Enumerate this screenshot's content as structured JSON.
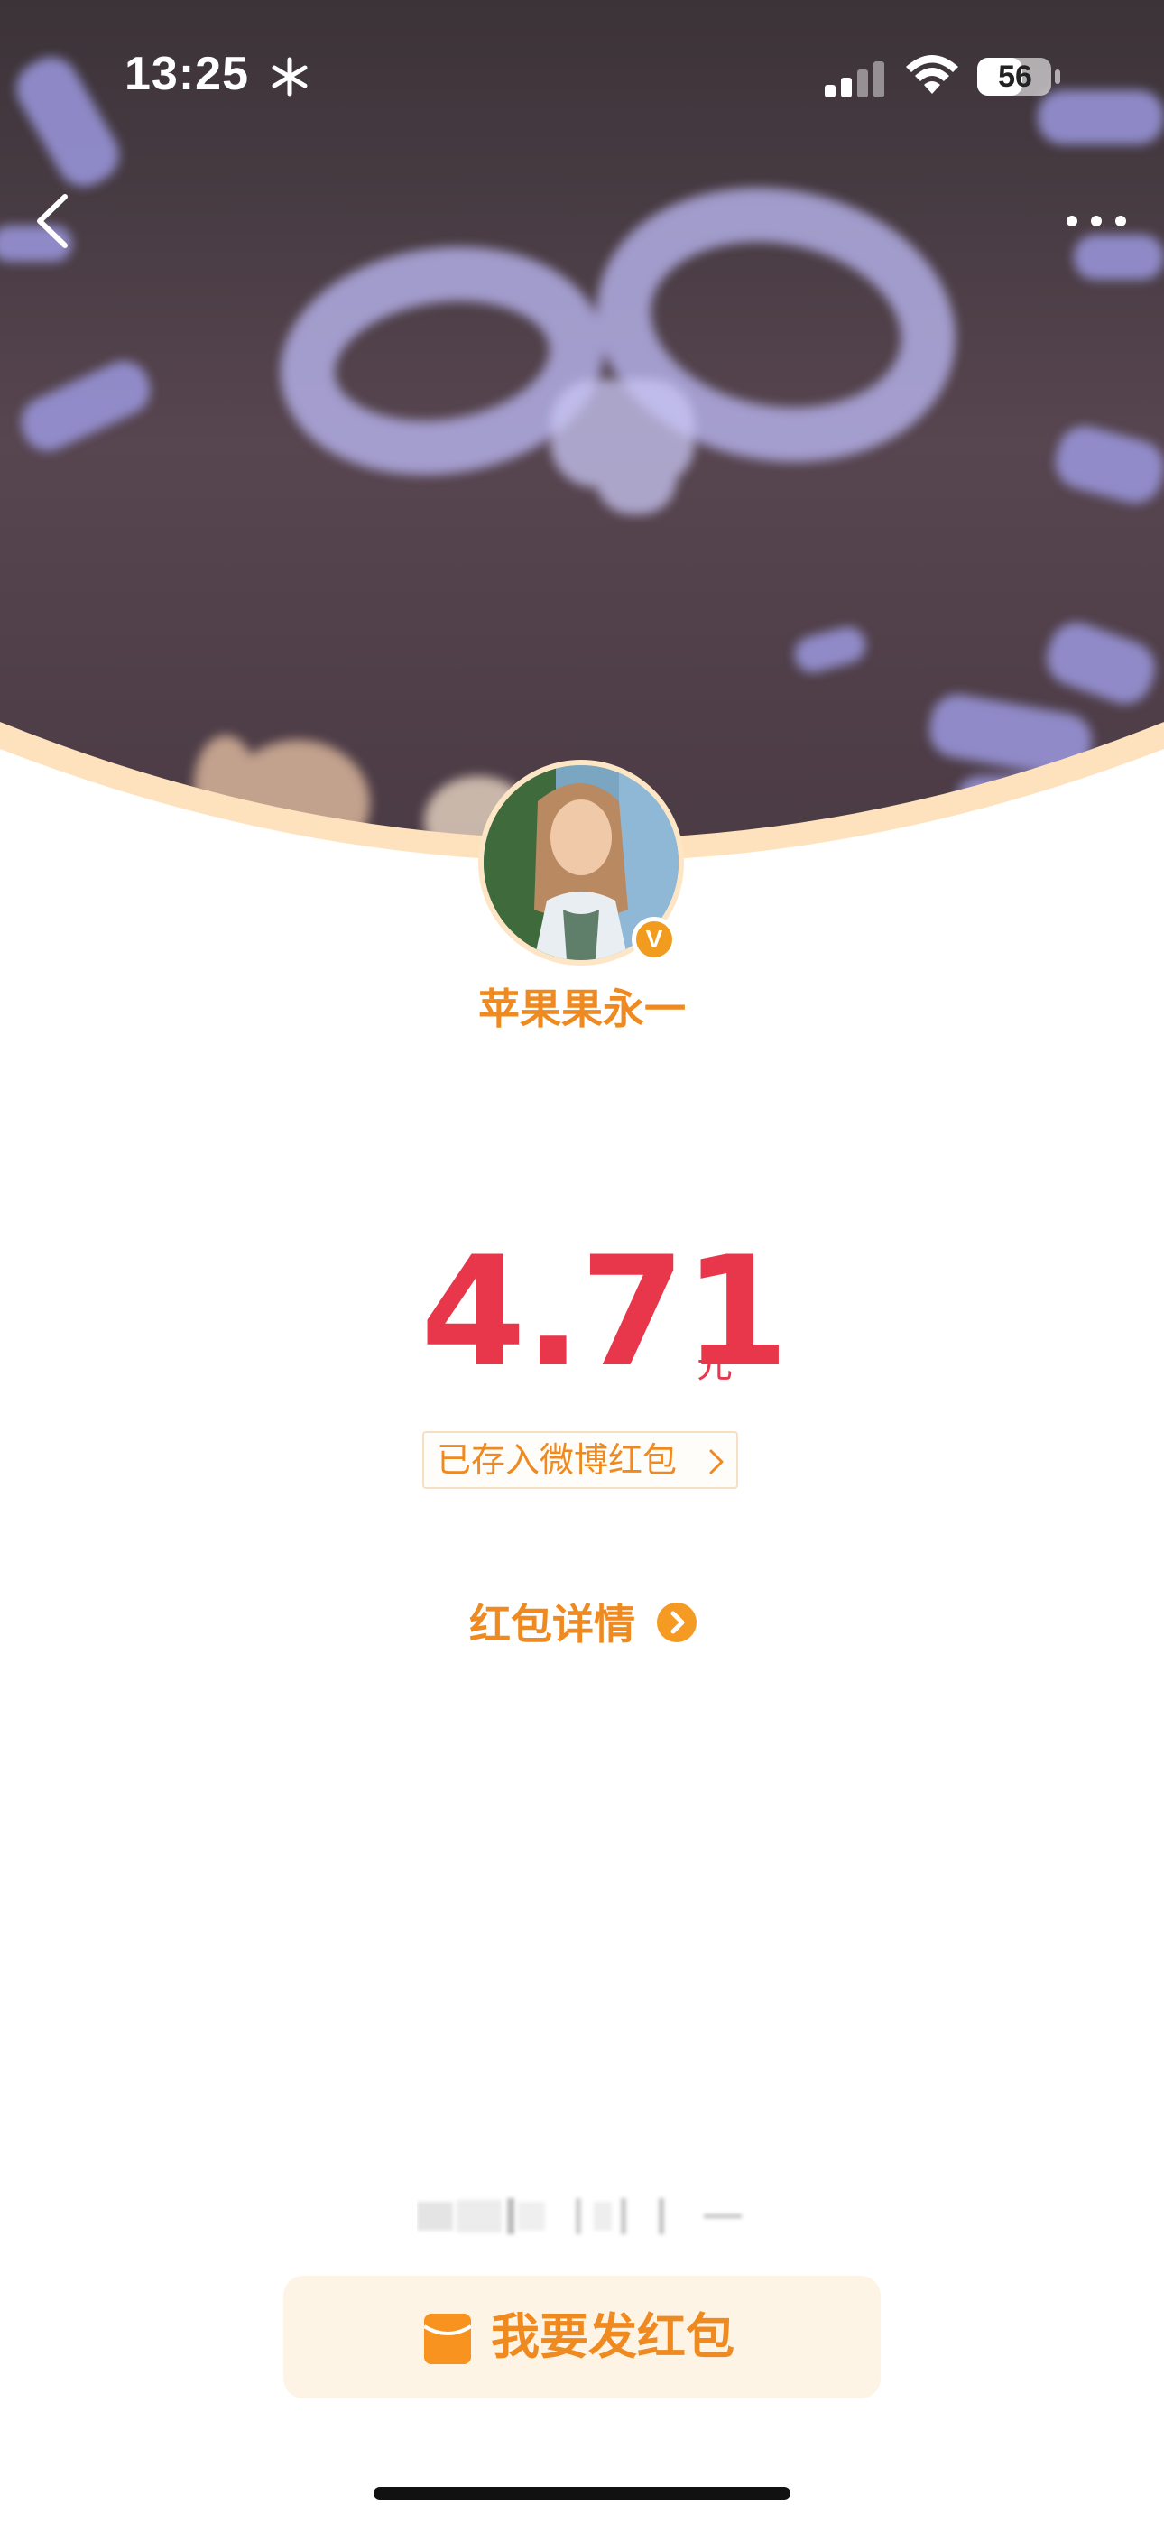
{
  "status_bar": {
    "time": "13:25",
    "battery": "56"
  },
  "profile": {
    "username": "苹果果永一",
    "verified_badge": "V"
  },
  "redpacket": {
    "amount": "4.71",
    "unit": "元",
    "saved_label": "已存入微博红包",
    "detail_label": "红包详情"
  },
  "footer": {
    "send_label": "我要发红包"
  },
  "colors": {
    "accent_orange": "#ef8a20",
    "amount_red": "#e8364a",
    "button_bg": "#fef4e6"
  },
  "icons": [
    "snowflake-icon",
    "signal-icon",
    "wifi-icon",
    "battery-icon",
    "back-chevron-icon",
    "more-dots-icon",
    "verified-icon",
    "chevron-right-icon",
    "arrow-circle-icon",
    "red-packet-icon"
  ]
}
